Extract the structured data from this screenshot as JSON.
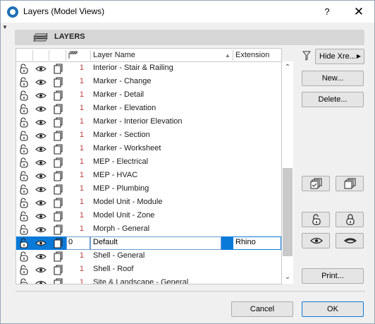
{
  "window": {
    "title": "Layers (Model Views)",
    "help_label": "?",
    "close_label": "✕"
  },
  "section": {
    "title": "LAYERS"
  },
  "table": {
    "columns": {
      "name": "Layer Name",
      "extension": "Extension"
    },
    "rows": [
      {
        "num": "1",
        "name": "Interior - Stair & Railing"
      },
      {
        "num": "1",
        "name": "Marker - Change"
      },
      {
        "num": "1",
        "name": "Marker - Detail"
      },
      {
        "num": "1",
        "name": "Marker - Elevation"
      },
      {
        "num": "1",
        "name": "Marker - Interior Elevation"
      },
      {
        "num": "1",
        "name": "Marker - Section"
      },
      {
        "num": "1",
        "name": "Marker - Worksheet"
      },
      {
        "num": "1",
        "name": "MEP - Electrical"
      },
      {
        "num": "1",
        "name": "MEP - HVAC"
      },
      {
        "num": "1",
        "name": "MEP - Plumbing"
      },
      {
        "num": "1",
        "name": "Model Unit - Module"
      },
      {
        "num": "1",
        "name": "Model Unit - Zone"
      },
      {
        "num": "1",
        "name": "Morph - General"
      },
      {
        "num": "0",
        "name": "Default",
        "extension": "Rhino",
        "selected": true
      },
      {
        "num": "1",
        "name": "Shell - General"
      },
      {
        "num": "1",
        "name": "Shell - Roof"
      },
      {
        "num": "1",
        "name": "Site & Landscape - General"
      }
    ]
  },
  "sidebar": {
    "hide_xref_label": "Hide Xre...",
    "new_label": "New...",
    "delete_label": "Delete...",
    "print_label": "Print..."
  },
  "footer": {
    "cancel_label": "Cancel",
    "ok_label": "OK"
  },
  "colors": {
    "accent": "#0a7ad9",
    "number": "#c0393b"
  }
}
